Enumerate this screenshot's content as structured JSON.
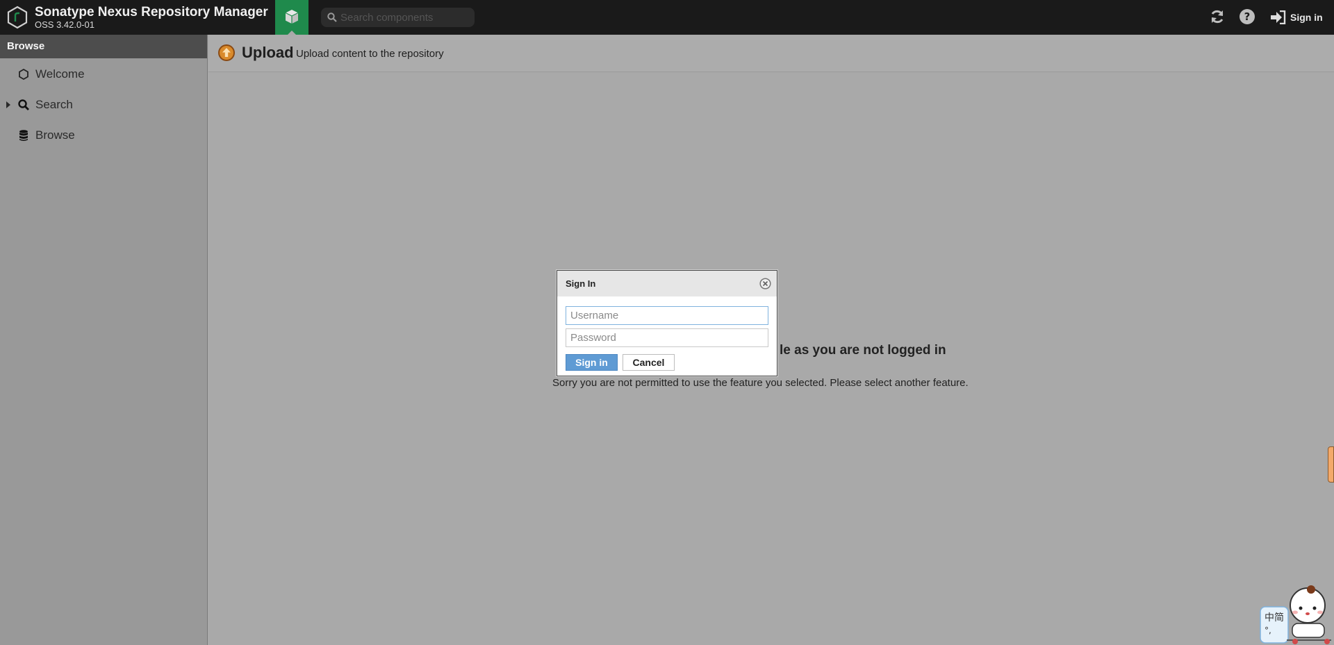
{
  "app": {
    "title": "Sonatype Nexus Repository Manager",
    "version": "OSS 3.42.0-01"
  },
  "header": {
    "search_placeholder": "Search components",
    "signin_label": "Sign in",
    "icons": [
      "nexus-logo-icon",
      "cube-icon",
      "search-icon",
      "refresh-icon",
      "help-icon",
      "sign-in-icon"
    ]
  },
  "sidebar": {
    "title": "Browse",
    "items": [
      {
        "label": "Welcome",
        "icon": "hexagon-icon"
      },
      {
        "label": "Search",
        "icon": "search-icon"
      },
      {
        "label": "Browse",
        "icon": "database-icon"
      }
    ]
  },
  "content": {
    "title": "Upload",
    "subtitle": "Upload content to the repository",
    "message_title": "le as you are not logged in",
    "message_body": "Sorry you are not permitted to use the feature you selected. Please select another feature."
  },
  "dialog": {
    "title": "Sign In",
    "username_placeholder": "Username",
    "password_placeholder": "Password",
    "signin_button": "Sign in",
    "cancel_button": "Cancel"
  },
  "colors": {
    "topbar": "#1a1a1a",
    "accent_green": "#1f8a4c",
    "primary_button": "#5f9bd4",
    "overlay_gray": "#a9a9a9"
  }
}
